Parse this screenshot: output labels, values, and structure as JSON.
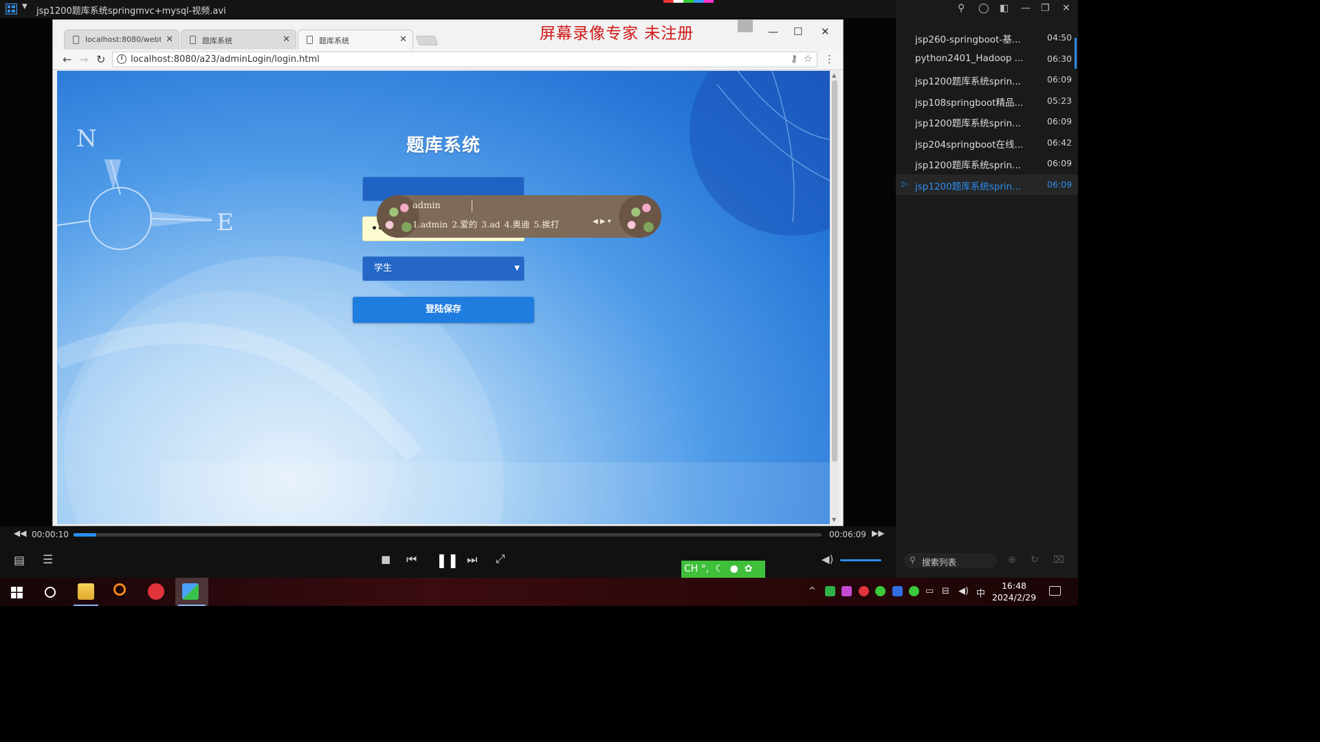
{
  "player": {
    "title": "jsp1200题库系统springmvc+mysql-视频.avi",
    "time_current": "00:00:10",
    "time_total": "00:06:09",
    "progress_fraction": 0.03,
    "volume_fraction": 0.75
  },
  "browser": {
    "tabs": [
      {
        "label": "localhost:8080/webtoc"
      },
      {
        "label": "题库系统"
      },
      {
        "label": "题库系统"
      }
    ],
    "url": "localhost:8080/a23/adminLogin/login.html",
    "watermark": "屏幕录像专家  未注册"
  },
  "login": {
    "title": "题库系统",
    "username_value": "",
    "password_mask": "••",
    "role_selected": "学生",
    "submit_label": "登陆保存"
  },
  "ime_popup": {
    "composition": "admin",
    "candidates": "1.admin 2.爱的  3.ad 4.奥迪 5.挨打"
  },
  "ime_bar": {
    "label": "CH °,"
  },
  "playlist": {
    "items": [
      {
        "name": "jsp260-springboot-基...",
        "duration": "04:50"
      },
      {
        "name": "python2401_Hadoop ...",
        "duration": "06:30"
      },
      {
        "name": "jsp1200题库系统sprin...",
        "duration": "06:09"
      },
      {
        "name": "jsp108springboot精品...",
        "duration": "05:23"
      },
      {
        "name": "jsp1200题库系统sprin...",
        "duration": "06:09"
      },
      {
        "name": "jsp204springboot在线...",
        "duration": "06:42"
      },
      {
        "name": "jsp1200题库系统sprin...",
        "duration": "06:09"
      },
      {
        "name": "jsp1200题库系统sprin...",
        "duration": "06:09",
        "active": true
      }
    ],
    "search_placeholder": "搜索列表"
  },
  "taskbar": {
    "clock_time": "16:48",
    "clock_date": "2024/2/29",
    "ime_indicator": "中"
  },
  "colors": {
    "accent": "#2e8ef0",
    "ime_green": "#3fbf3a",
    "watermark_red": "#d01818"
  }
}
